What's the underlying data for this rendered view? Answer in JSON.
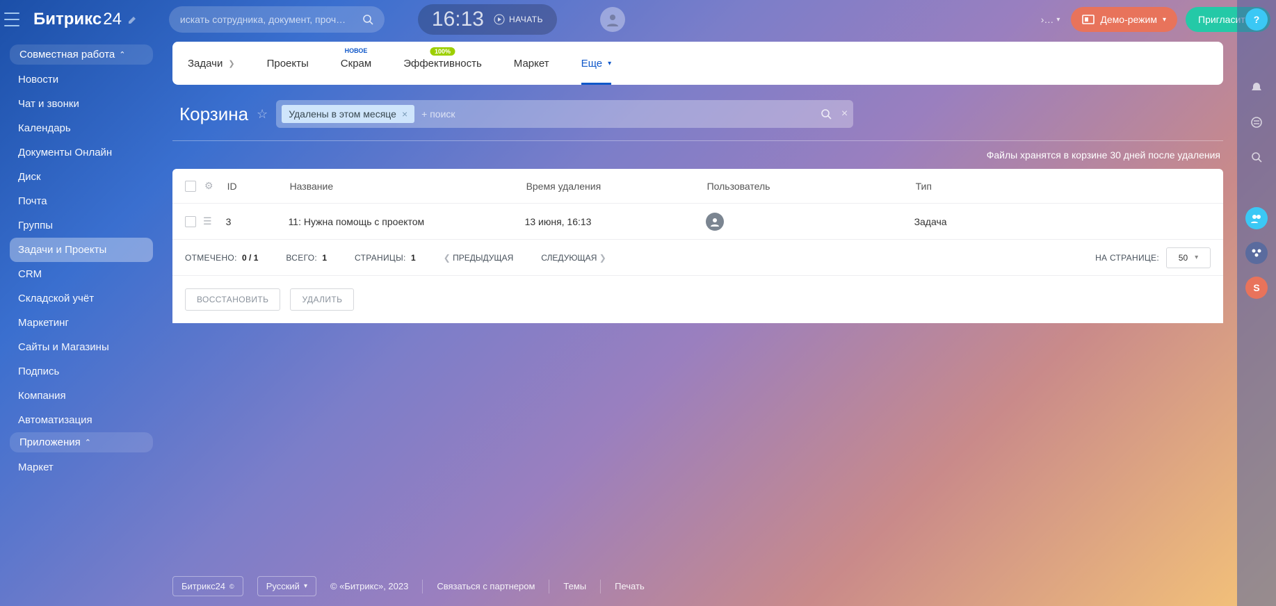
{
  "header": {
    "app_name": "Битрикс",
    "app_suffix": "24",
    "search_placeholder": "искать сотрудника, документ, проч…",
    "clock_time": "16:13",
    "clock_start": "НАЧАТЬ",
    "demo_label": "Демо-режим",
    "invite_label": "Пригласить",
    "help_char": "?",
    "rail_s": "S",
    "user_dots": "›…"
  },
  "sidebar": {
    "groups": [
      {
        "label": "Совместная работа",
        "expanded": true
      },
      {
        "label": "Приложения",
        "expanded": true
      }
    ],
    "items_top": [
      "Новости",
      "Чат и звонки",
      "Календарь",
      "Документы Онлайн",
      "Диск",
      "Почта",
      "Группы"
    ],
    "active_item": "Задачи и Проекты",
    "items_mid": [
      "CRM",
      "Складской учёт",
      "Маркетинг",
      "Сайты и Магазины",
      "Подпись",
      "Компания",
      "Автоматизация"
    ],
    "items_bottom": [
      "Маркет"
    ]
  },
  "tabs": [
    {
      "label": "Задачи",
      "arrow": true
    },
    {
      "label": "Проекты"
    },
    {
      "label": "Скрам",
      "badge": "НОВОЕ",
      "badge_type": "new"
    },
    {
      "label": "Эффективность",
      "badge": "100%",
      "badge_type": "pct"
    },
    {
      "label": "Маркет"
    },
    {
      "label": "Еще",
      "dropdown": true,
      "active": true
    }
  ],
  "page": {
    "title": "Корзина",
    "filter_chip": "Удалены в этом месяце",
    "filter_placeholder": "+ поиск",
    "retention_text": "Файлы хранятся в корзине 30 дней после удаления"
  },
  "table": {
    "cols": {
      "id": "ID",
      "name": "Название",
      "time": "Время удаления",
      "user": "Пользователь",
      "type": "Тип"
    },
    "rows": [
      {
        "id": "3",
        "name": "11: Нужна помощь с проектом",
        "time": "13 июня, 16:13",
        "type": "Задача"
      }
    ]
  },
  "pager": {
    "selected_label": "ОТМЕЧЕНО:",
    "selected_val": "0 / 1",
    "total_label": "ВСЕГО:",
    "total_val": "1",
    "pages_label": "СТРАНИЦЫ:",
    "pages_val": "1",
    "prev": "ПРЕДЫДУЩАЯ",
    "next": "СЛЕДУЮЩАЯ",
    "per_page_label": "НА СТРАНИЦЕ:",
    "per_page_val": "50"
  },
  "actions": {
    "restore": "ВОССТАНОВИТЬ",
    "delete": "УДАЛИТЬ"
  },
  "footer": {
    "brand": "Битрикс24",
    "lang": "Русский",
    "copyright": "© «Битрикс», 2023",
    "partner": "Связаться с партнером",
    "themes": "Темы",
    "print": "Печать"
  }
}
